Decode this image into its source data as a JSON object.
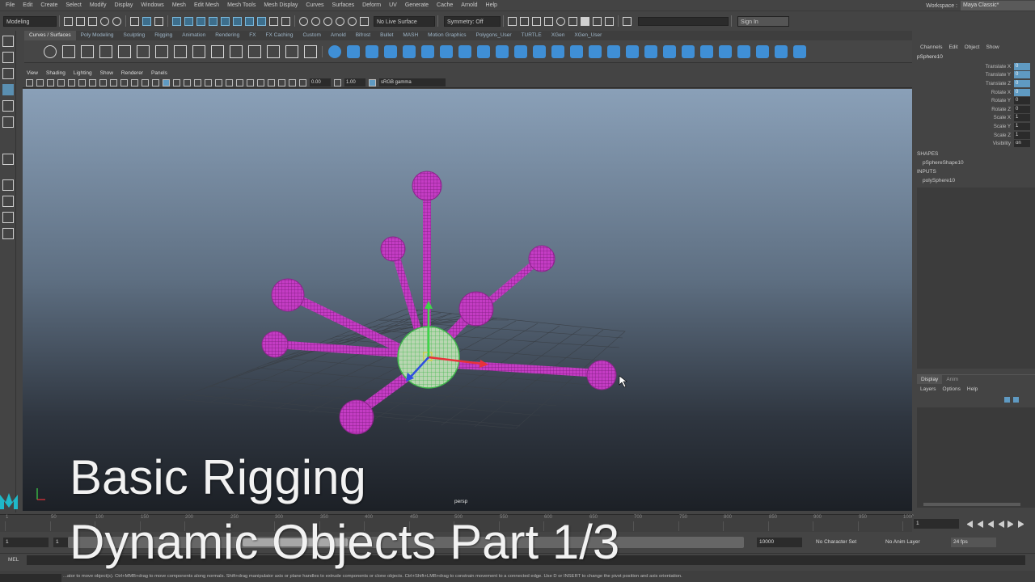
{
  "menubar": {
    "items": [
      "File",
      "Edit",
      "Create",
      "Select",
      "Modify",
      "Display",
      "Windows",
      "Mesh",
      "Edit Mesh",
      "Mesh Tools",
      "Mesh Display",
      "Curves",
      "Surfaces",
      "Deform",
      "UV",
      "Generate",
      "Cache",
      "Arnold",
      "Help"
    ],
    "workspace_label": "Workspace :",
    "workspace_value": "Maya Classic*"
  },
  "statusline": {
    "mode": "Modeling",
    "live_surface": "No Live Surface",
    "symmetry": "Symmetry: Off",
    "sign_in": "Sign In"
  },
  "shelf": {
    "tabs": [
      "Curves / Surfaces",
      "Poly Modeling",
      "Sculpting",
      "Rigging",
      "Animation",
      "Rendering",
      "FX",
      "FX Caching",
      "Custom",
      "Arnold",
      "Bifrost",
      "Bullet",
      "MASH",
      "Motion Graphics",
      "Polygons_User",
      "TURTLE",
      "XGen",
      "XGen_User"
    ],
    "active_tab": "Curves / Surfaces"
  },
  "viewport": {
    "menus": [
      "View",
      "Shading",
      "Lighting",
      "Show",
      "Renderer",
      "Panels"
    ],
    "exposure": "0.00",
    "gamma": "1.00",
    "color_space": "sRGB gamma",
    "camera_label": "persp"
  },
  "channelbox": {
    "tabs": [
      "Channels",
      "Edit",
      "Object",
      "Show"
    ],
    "object_name": "pSphere10",
    "channels": [
      {
        "name": "Translate X",
        "value": "0"
      },
      {
        "name": "Translate Y",
        "value": "0"
      },
      {
        "name": "Translate Z",
        "value": "0"
      },
      {
        "name": "Rotate X",
        "value": "0"
      },
      {
        "name": "Rotate Y",
        "value": "0"
      },
      {
        "name": "Rotate Z",
        "value": "0"
      },
      {
        "name": "Scale X",
        "value": "1"
      },
      {
        "name": "Scale Y",
        "value": "1"
      },
      {
        "name": "Scale Z",
        "value": "1"
      },
      {
        "name": "Visibility",
        "value": "on"
      }
    ],
    "shapes_header": "SHAPES",
    "shape_name": "pSphereShape10",
    "inputs_header": "INPUTS",
    "input_name": "polySphere10"
  },
  "layers": {
    "tabs": [
      "Display",
      "Anim"
    ],
    "menus": [
      "Layers",
      "Options",
      "Help"
    ]
  },
  "timeslider": {
    "ticks": [
      "1",
      "50",
      "100",
      "150",
      "200",
      "250",
      "300",
      "350",
      "400",
      "450",
      "500",
      "550",
      "600",
      "650",
      "700",
      "750",
      "800",
      "850",
      "900",
      "950",
      "1000"
    ],
    "current_frame": "1"
  },
  "range": {
    "start": "1",
    "inner_start": "1",
    "end": "10000",
    "char_set": "No Character Set",
    "anim_layer": "No Anim Layer",
    "fps": "24 fps"
  },
  "cmdline": {
    "label": "MEL",
    "help_text": "...ator to move object(s). Ctrl+MMB+drag to move components along normals. Shift+drag manipulator axis or plane handles to extrude components or clone objects. Ctrl+Shift+LMB+drag to constrain movement to a connected edge. Use D or INSERT to change the pivot position and axis orientation."
  },
  "overlay": {
    "line1": "Basic Rigging",
    "line2": "Dynamic Objects Part 1/3"
  },
  "colors": {
    "accent": "#5f9ac2",
    "object_magenta": "#cc33cc",
    "viewport_top": "#8aa0b8"
  }
}
